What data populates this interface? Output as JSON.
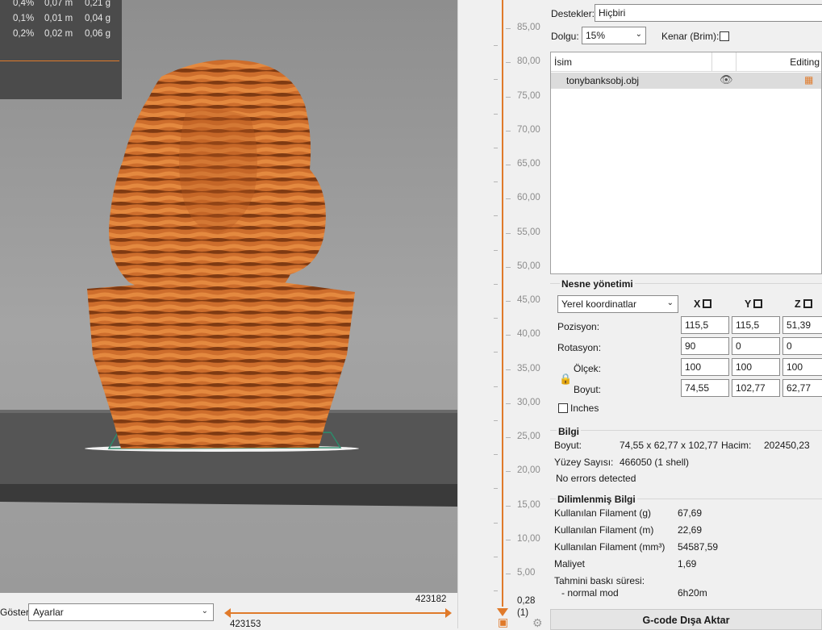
{
  "stats": {
    "rows": [
      [
        "0,4%",
        "0,07 m",
        "0,21 g"
      ],
      [
        "0,1%",
        "0,01 m",
        "0,04 g"
      ],
      [
        "0,2%",
        "0,02 m",
        "0,06 g"
      ]
    ]
  },
  "viewport": {
    "show_label": "Göster",
    "show_value": "Ayarlar",
    "h_slider_top": "423182",
    "h_slider_bottom": "423153"
  },
  "layer_slider": {
    "ticks": [
      "85,00",
      "80,00",
      "75,00",
      "70,00",
      "65,00",
      "60,00",
      "55,00",
      "50,00",
      "45,00",
      "40,00",
      "35,00",
      "30,00",
      "25,00",
      "20,00",
      "15,00",
      "10,00",
      "5,00"
    ],
    "bottom_value": "0,28",
    "bottom_index": "(1)"
  },
  "settings": {
    "supports_label": "Destekler:",
    "supports_value": "Hiçbiri",
    "infill_label": "Dolgu:",
    "infill_value": "15%",
    "brim_label": "Kenar (Brim):"
  },
  "object_list": {
    "col_name": "İsim",
    "col_editing": "Editing",
    "objects": [
      {
        "name": "tonybanksobj.obj"
      }
    ]
  },
  "object_manipulation": {
    "title": "Nesne yönetimi",
    "coord_system": "Yerel koordinatlar",
    "axes": [
      "X",
      "Y",
      "Z"
    ],
    "rows": [
      {
        "label": "Pozisyon:",
        "values": [
          "115,5",
          "115,5",
          "51,39"
        ]
      },
      {
        "label": "Rotasyon:",
        "values": [
          "90",
          "0",
          "0"
        ]
      },
      {
        "label": "Ölçek:",
        "values": [
          "100",
          "100",
          "100"
        ]
      },
      {
        "label": "Boyut:",
        "values": [
          "74,55",
          "102,77",
          "62,77"
        ]
      }
    ],
    "inches_label": "Inches"
  },
  "info": {
    "title": "Bilgi",
    "size_label": "Boyut:",
    "size_value": "74,55 x 62,77 x 102,77",
    "volume_label": "Hacim:",
    "volume_value": "202450,23",
    "facets_label": "Yüzey Sayısı:",
    "facets_value": "466050 (1 shell)",
    "errors": "No errors detected"
  },
  "sliced_info": {
    "title": "Dilimlenmiş Bilgi",
    "rows": [
      {
        "label": "Kullanılan Filament (g)",
        "value": "67,69"
      },
      {
        "label": "Kullanılan Filament (m)",
        "value": "22,69"
      },
      {
        "label": "Kullanılan Filament (mm³)",
        "value": "54587,59"
      },
      {
        "label": "Maliyet",
        "value": "1,69"
      }
    ],
    "print_time_label": "Tahmini baskı süresi:",
    "normal_mode_label": "- normal mod",
    "normal_mode_value": "6h20m"
  },
  "export_button": "G-code Dışa Aktar",
  "colors": {
    "accent": "#e07a2a",
    "model": "#c8662a",
    "model_dark": "#8a3f14"
  }
}
